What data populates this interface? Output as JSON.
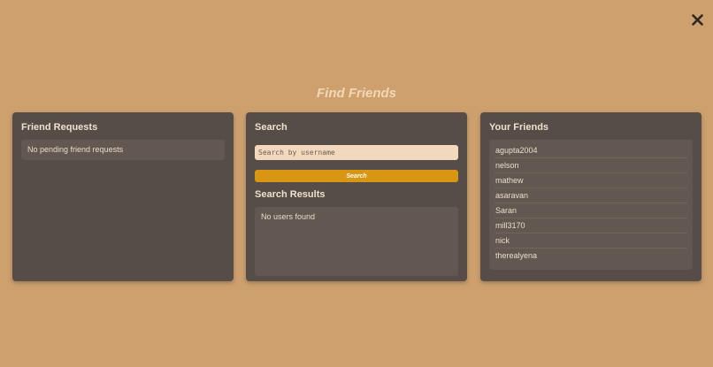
{
  "page": {
    "title": "Find Friends"
  },
  "close": {
    "icon": "close-icon"
  },
  "friend_requests": {
    "title": "Friend Requests",
    "empty_text": "No pending friend requests"
  },
  "search": {
    "title": "Search",
    "placeholder": "Search by username",
    "value": "",
    "button_label": "Search",
    "results_title": "Search Results",
    "results_empty_text": "No users found"
  },
  "friends": {
    "title": "Your Friends",
    "items": [
      {
        "name": "agupta2004"
      },
      {
        "name": "nelson"
      },
      {
        "name": "mathew"
      },
      {
        "name": "asaravan"
      },
      {
        "name": "Saran"
      },
      {
        "name": "mill3170"
      },
      {
        "name": "nick"
      },
      {
        "name": "therealyena"
      }
    ]
  },
  "colors": {
    "background": "#cda06e",
    "panel": "#574d48",
    "inner_box": "#625851",
    "accent_button": "#d99612",
    "input_bg": "#f2d9bd",
    "title_text": "#f2d8b6"
  }
}
